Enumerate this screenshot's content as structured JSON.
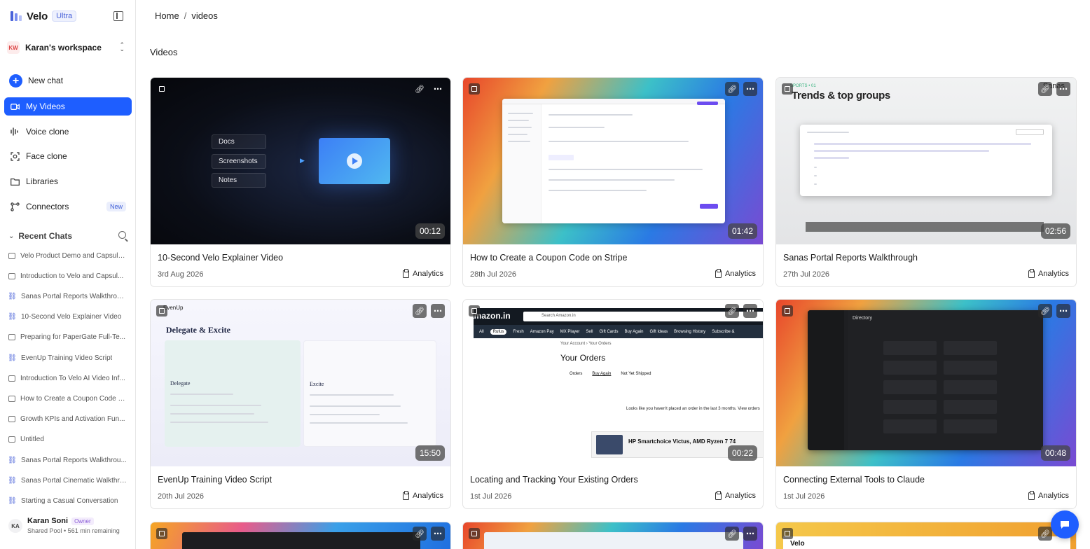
{
  "app": {
    "name": "Velo",
    "plan_badge": "Ultra"
  },
  "workspace": {
    "initials": "KW",
    "name": "Karan's workspace"
  },
  "nav": {
    "new_chat": "New chat",
    "my_videos": "My Videos",
    "voice_clone": "Voice clone",
    "face_clone": "Face clone",
    "libraries": "Libraries",
    "connectors": "Connectors",
    "connectors_badge": "New"
  },
  "recent": {
    "header": "Recent Chats",
    "items": [
      {
        "label": "Velo Product Demo and Capsule...",
        "icon": "chat-bubble"
      },
      {
        "label": "Introduction to Velo and Capsul...",
        "icon": "chat-bubble"
      },
      {
        "label": "Sanas Portal Reports Walkthrough",
        "icon": "workflow"
      },
      {
        "label": "10-Second Velo Explainer Video",
        "icon": "workflow"
      },
      {
        "label": "Preparing for PaperGate Full-Te...",
        "icon": "chat-bubble"
      },
      {
        "label": "EvenUp Training Video Script",
        "icon": "workflow"
      },
      {
        "label": "Introduction To Velo AI Video Inf...",
        "icon": "chat-bubble"
      },
      {
        "label": "How to Create a Coupon Code o...",
        "icon": "chat-bubble"
      },
      {
        "label": "Growth KPIs and Activation Fun...",
        "icon": "chat-bubble"
      },
      {
        "label": "Untitled",
        "icon": "chat-bubble"
      },
      {
        "label": "Sanas Portal Reports Walkthrou...",
        "icon": "workflow"
      },
      {
        "label": "Sanas Portal Cinematic Walkthro...",
        "icon": "workflow"
      },
      {
        "label": "Starting a Casual Conversation",
        "icon": "workflow"
      }
    ]
  },
  "user": {
    "initials": "KA",
    "name": "Karan Soni",
    "role": "Owner",
    "sub": "Shared Pool • 561 min remaining"
  },
  "breadcrumb": {
    "home": "Home",
    "sep": "/",
    "current": "videos"
  },
  "page_title": "Videos",
  "analytics_label": "Analytics",
  "videos": [
    {
      "title": "10-Second Velo Explainer Video",
      "date": "3rd Aug 2026",
      "duration": "00:12"
    },
    {
      "title": "How to Create a Coupon Code on Stripe",
      "date": "28th Jul 2026",
      "duration": "01:42"
    },
    {
      "title": "Sanas Portal Reports Walkthrough",
      "date": "27th Jul 2026",
      "duration": "02:56"
    },
    {
      "title": "EvenUp Training Video Script",
      "date": "20th Jul 2026",
      "duration": "15:50"
    },
    {
      "title": "Locating and Tracking Your Existing Orders",
      "date": "1st Jul 2026",
      "duration": "00:22"
    },
    {
      "title": "Connecting External Tools to Claude",
      "date": "1st Jul 2026",
      "duration": "00:48"
    }
  ],
  "thumb1": {
    "pills": [
      "Docs",
      "Screenshots",
      "Notes"
    ]
  },
  "thumb3": {
    "tag": "SPORTS • 01",
    "heading": "Trends & top groups",
    "brand": "Sanas"
  },
  "thumb4": {
    "logo": "EvenUp",
    "heading": "Delegate & Excite",
    "col1": "Delegate",
    "col2": "Excite"
  },
  "thumb5": {
    "logo": "amazon.in",
    "search": "Search Amazon.in",
    "nav": [
      "All",
      "Rufus",
      "Fresh",
      "Amazon Pay",
      "MX Player",
      "Sell",
      "Gift Cards",
      "Buy Again",
      "Gift Ideas",
      "Browsing History",
      "Subscribe &"
    ],
    "crumb": "Your Account › Your Orders",
    "heading": "Your Orders",
    "tabs": [
      "Orders",
      "Buy Again",
      "Not Yet Shipped"
    ],
    "message": "Looks like you haven't placed an order in the last 3 months. View orders",
    "ad": "HP Smartchoice Victus, AMD Ryzen 7 74"
  },
  "thumb6": {
    "heading": "Directory"
  },
  "row3_partial": {
    "brand": "Velo"
  }
}
